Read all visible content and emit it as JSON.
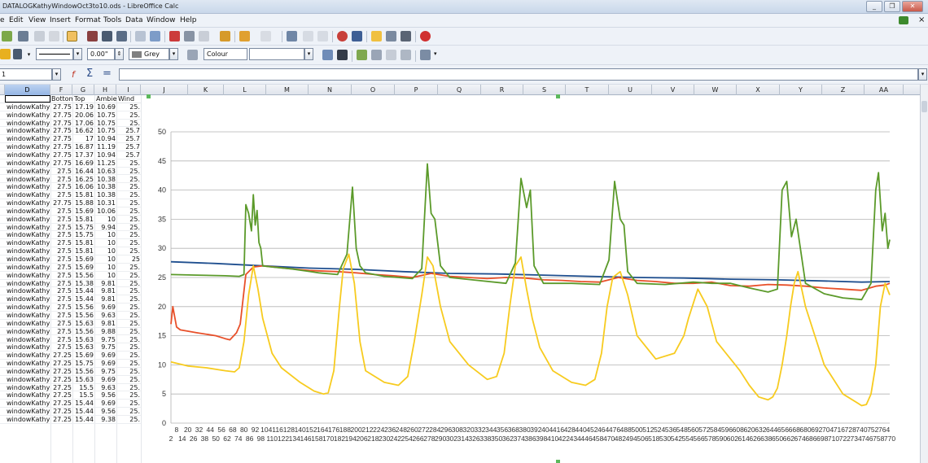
{
  "window": {
    "title": "DATALOGKathyWindowOct3to10.ods - LibreOffice Calc",
    "buttons": [
      "_",
      "❐",
      "✕"
    ]
  },
  "menu": [
    "e",
    "Edit",
    "View",
    "Insert",
    "Format",
    "Tools",
    "Data",
    "Window",
    "Help"
  ],
  "toolbar2": {
    "line_width": "0.00\"",
    "line_color": "Grey",
    "area_style": "Colour"
  },
  "formula_bar": {
    "name_box": "1",
    "value": ""
  },
  "columns": [
    "D",
    "F",
    "G",
    "H",
    "I",
    "J",
    "K",
    "L",
    "M",
    "N",
    "O",
    "P",
    "Q",
    "R",
    "S",
    "T",
    "U",
    "V",
    "W",
    "X",
    "Y",
    "Z",
    "AA"
  ],
  "header_row": [
    "",
    "Bottom",
    "Top",
    "Ambie",
    "Wind"
  ],
  "rows": [
    [
      "windowKathy",
      "27.75",
      "17.19",
      "10.69",
      "25."
    ],
    [
      "windowKathy",
      "27.75",
      "20.06",
      "10.75",
      "25."
    ],
    [
      "windowKathy",
      "27.75",
      "17.06",
      "10.75",
      "25."
    ],
    [
      "windowKathy",
      "27.75",
      "16.62",
      "10.75",
      "25.7"
    ],
    [
      "windowKathy",
      "27.75",
      "17",
      "10.94",
      "25.7"
    ],
    [
      "windowKathy",
      "27.75",
      "16.87",
      "11.19",
      "25.7"
    ],
    [
      "windowKathy",
      "27.75",
      "17.37",
      "10.94",
      "25.7"
    ],
    [
      "windowKathy",
      "27.75",
      "16.69",
      "11.25",
      "25."
    ],
    [
      "windowKathy",
      "27.5",
      "16.44",
      "10.63",
      "25."
    ],
    [
      "windowKathy",
      "27.5",
      "16.25",
      "10.38",
      "25."
    ],
    [
      "windowKathy",
      "27.5",
      "16.06",
      "10.38",
      "25."
    ],
    [
      "windowKathy",
      "27.5",
      "15.81",
      "10.38",
      "25."
    ],
    [
      "windowKathy",
      "27.75",
      "15.88",
      "10.31",
      "25."
    ],
    [
      "windowKathy",
      "27.5",
      "15.69",
      "10.06",
      "25."
    ],
    [
      "windowKathy",
      "27.5",
      "15.81",
      "10",
      "25."
    ],
    [
      "windowKathy",
      "27.5",
      "15.75",
      "9.94",
      "25."
    ],
    [
      "windowKathy",
      "27.5",
      "15.75",
      "10",
      "25."
    ],
    [
      "windowKathy",
      "27.5",
      "15.81",
      "10",
      "25."
    ],
    [
      "windowKathy",
      "27.5",
      "15.81",
      "10",
      "25."
    ],
    [
      "windowKathy",
      "27.5",
      "15.69",
      "10",
      "25"
    ],
    [
      "windowKathy",
      "27.5",
      "15.69",
      "10",
      "25."
    ],
    [
      "windowKathy",
      "27.5",
      "15.56",
      "10",
      "25."
    ],
    [
      "windowKathy",
      "27.5",
      "15.38",
      "9.81",
      "25."
    ],
    [
      "windowKathy",
      "27.5",
      "15.44",
      "9.81",
      "25."
    ],
    [
      "windowKathy",
      "27.5",
      "15.44",
      "9.81",
      "25."
    ],
    [
      "windowKathy",
      "27.5",
      "15.56",
      "9.69",
      "25."
    ],
    [
      "windowKathy",
      "27.5",
      "15.56",
      "9.63",
      "25."
    ],
    [
      "windowKathy",
      "27.5",
      "15.63",
      "9.81",
      "25."
    ],
    [
      "windowKathy",
      "27.5",
      "15.56",
      "9.88",
      "25."
    ],
    [
      "windowKathy",
      "27.5",
      "15.63",
      "9.75",
      "25."
    ],
    [
      "windowKathy",
      "27.5",
      "15.63",
      "9.75",
      "25."
    ],
    [
      "windowKathy",
      "27.25",
      "15.69",
      "9.69",
      "25."
    ],
    [
      "windowKathy",
      "27.25",
      "15.75",
      "9.69",
      "25."
    ],
    [
      "windowKathy",
      "27.25",
      "15.56",
      "9.75",
      "25."
    ],
    [
      "windowKathy",
      "27.25",
      "15.63",
      "9.69",
      "25."
    ],
    [
      "windowKathy",
      "27.25",
      "15.5",
      "9.63",
      "25."
    ],
    [
      "windowKathy",
      "27.25",
      "15.5",
      "9.56",
      "25."
    ],
    [
      "windowKathy",
      "27.25",
      "15.44",
      "9.69",
      "25."
    ],
    [
      "windowKathy",
      "27.25",
      "15.44",
      "9.56",
      "25."
    ],
    [
      "windowKathy",
      "27.25",
      "15.44",
      "9.38",
      "25."
    ]
  ],
  "colors": {
    "blue": "#1f4f8f",
    "red": "#e8502a",
    "green": "#5b9a2a",
    "yellow": "#f7cb1f"
  },
  "chart_data": {
    "type": "line",
    "ylim": [
      0,
      50
    ],
    "yticks": [
      0,
      5,
      10,
      15,
      20,
      25,
      30,
      35,
      40,
      45,
      50
    ],
    "xlim": [
      2,
      770
    ],
    "xticks_top": [
      "8",
      "20",
      "32",
      "44",
      "56",
      "68",
      "80",
      "92",
      "104",
      "116",
      "128",
      "140",
      "152",
      "164",
      "176",
      "188",
      "200",
      "212",
      "224",
      "236",
      "248",
      "260",
      "272",
      "284",
      "296",
      "308",
      "320",
      "332",
      "344",
      "356",
      "368",
      "380",
      "392",
      "404",
      "416",
      "428",
      "440",
      "452",
      "464",
      "476",
      "488",
      "500",
      "512",
      "524",
      "536",
      "548",
      "560",
      "572",
      "584",
      "596",
      "608",
      "620",
      "632",
      "644",
      "656",
      "668",
      "680",
      "692",
      "704",
      "716",
      "728",
      "740",
      "752",
      "764"
    ],
    "xticks_bottom": [
      "2",
      "14",
      "26",
      "38",
      "50",
      "62",
      "74",
      "86",
      "98",
      "110",
      "122",
      "134",
      "146",
      "158",
      "170",
      "182",
      "194",
      "206",
      "218",
      "230",
      "242",
      "254",
      "266",
      "278",
      "290",
      "302",
      "314",
      "326",
      "338",
      "350",
      "362",
      "374",
      "386",
      "398",
      "410",
      "422",
      "434",
      "446",
      "458",
      "470",
      "482",
      "494",
      "506",
      "518",
      "530",
      "542",
      "554",
      "566",
      "578",
      "590",
      "602",
      "614",
      "626",
      "638",
      "650",
      "662",
      "674",
      "686",
      "698",
      "710",
      "722",
      "734",
      "746",
      "758",
      "770"
    ],
    "series": [
      {
        "color": "#1f4f8f",
        "x": [
          2,
          50,
          100,
          150,
          200,
          250,
          300,
          350,
          400,
          450,
          500,
          550,
          600,
          650,
          700,
          740,
          770
        ],
        "values": [
          27.7,
          27.4,
          27.0,
          26.6,
          26.4,
          26.0,
          25.7,
          25.6,
          25.4,
          25.2,
          25.0,
          24.9,
          24.7,
          24.6,
          24.4,
          24.2,
          24.3
        ]
      },
      {
        "color": "#e8502a",
        "x": [
          2,
          4,
          8,
          12,
          30,
          50,
          60,
          65,
          72,
          76,
          82,
          90,
          100,
          130,
          150,
          180,
          200,
          220,
          240,
          260,
          280,
          300,
          320,
          340,
          360,
          380,
          400,
          420,
          440,
          460,
          480,
          500,
          520,
          540,
          560,
          580,
          600,
          620,
          640,
          660,
          680,
          700,
          720,
          740,
          755,
          765,
          770
        ],
        "values": [
          17.0,
          20.0,
          16.5,
          16.0,
          15.5,
          15.0,
          14.5,
          14.3,
          15.5,
          17.0,
          25.5,
          26.8,
          27.0,
          26.5,
          26.2,
          26.0,
          25.8,
          25.5,
          25.3,
          25.0,
          25.7,
          25.2,
          25.0,
          24.8,
          25.0,
          24.9,
          24.6,
          24.5,
          24.3,
          24.2,
          25.0,
          24.5,
          24.3,
          24.0,
          24.0,
          24.2,
          23.6,
          23.5,
          23.8,
          23.7,
          23.5,
          23.2,
          23.0,
          22.8,
          23.5,
          23.7,
          24.0
        ]
      },
      {
        "color": "#5b9a2a",
        "x": [
          2,
          30,
          60,
          75,
          80,
          82,
          85,
          88,
          90,
          92,
          94,
          96,
          98,
          100,
          110,
          130,
          160,
          180,
          190,
          196,
          200,
          204,
          210,
          230,
          260,
          270,
          276,
          280,
          284,
          290,
          300,
          330,
          360,
          370,
          376,
          382,
          386,
          390,
          400,
          430,
          460,
          470,
          476,
          482,
          486,
          490,
          500,
          530,
          560,
          580,
          600,
          620,
          640,
          650,
          655,
          660,
          665,
          670,
          680,
          700,
          720,
          740,
          750,
          755,
          758,
          762,
          765,
          768,
          770
        ],
        "values": [
          25.5,
          25.4,
          25.3,
          25.2,
          25.5,
          37.5,
          36.0,
          33.0,
          39.2,
          34.0,
          36.5,
          31.0,
          30.0,
          27.0,
          26.8,
          26.5,
          25.8,
          25.5,
          29.0,
          40.5,
          30.0,
          27.0,
          25.8,
          25.2,
          24.8,
          26.5,
          44.5,
          36.0,
          35.0,
          27.0,
          25.0,
          24.5,
          24.0,
          27.5,
          42.0,
          37.0,
          40.0,
          27.0,
          24.0,
          24.0,
          23.8,
          28.0,
          41.5,
          35.0,
          34.0,
          26.0,
          24.0,
          23.8,
          24.2,
          24.0,
          24.0,
          23.2,
          22.5,
          23.0,
          40.0,
          41.5,
          32.0,
          35.0,
          24.0,
          22.2,
          21.5,
          21.2,
          24.0,
          40.0,
          43.0,
          33.0,
          36.0,
          30.0,
          31.5
        ]
      },
      {
        "color": "#f7cb1f",
        "x": [
          2,
          10,
          20,
          40,
          60,
          70,
          75,
          80,
          85,
          90,
          95,
          100,
          110,
          120,
          140,
          155,
          165,
          170,
          176,
          182,
          186,
          192,
          198,
          204,
          210,
          230,
          245,
          255,
          262,
          270,
          276,
          282,
          290,
          300,
          320,
          340,
          350,
          358,
          364,
          370,
          376,
          382,
          388,
          396,
          410,
          430,
          445,
          455,
          462,
          468,
          474,
          482,
          490,
          500,
          520,
          540,
          550,
          555,
          565,
          575,
          585,
          600,
          610,
          620,
          630,
          640,
          645,
          650,
          655,
          660,
          664,
          668,
          672,
          680,
          700,
          720,
          735,
          740,
          745,
          750,
          755,
          760,
          765,
          770
        ],
        "values": [
          10.5,
          10.2,
          9.8,
          9.5,
          9.0,
          8.8,
          9.5,
          14.0,
          22.0,
          27.0,
          23.0,
          18.0,
          12.0,
          9.5,
          7.0,
          5.5,
          5.0,
          5.2,
          9.0,
          20.0,
          26.5,
          29.0,
          24.0,
          14.0,
          9.0,
          7.0,
          6.5,
          8.0,
          14.0,
          22.0,
          28.5,
          27.0,
          20.0,
          14.0,
          10.0,
          7.5,
          8.0,
          12.0,
          20.0,
          27.0,
          28.5,
          23.0,
          18.0,
          13.0,
          9.0,
          7.0,
          6.5,
          7.5,
          12.0,
          20.0,
          25.0,
          26.0,
          22.0,
          15.0,
          11.0,
          12.0,
          15.0,
          18.0,
          23.0,
          20.0,
          14.0,
          11.0,
          9.0,
          6.5,
          4.5,
          4.0,
          4.5,
          6.0,
          10.0,
          15.0,
          20.0,
          24.0,
          26.0,
          20.0,
          10.0,
          5.0,
          3.5,
          3.0,
          3.2,
          5.0,
          10.0,
          20.0,
          24.0,
          22.0
        ]
      }
    ]
  }
}
